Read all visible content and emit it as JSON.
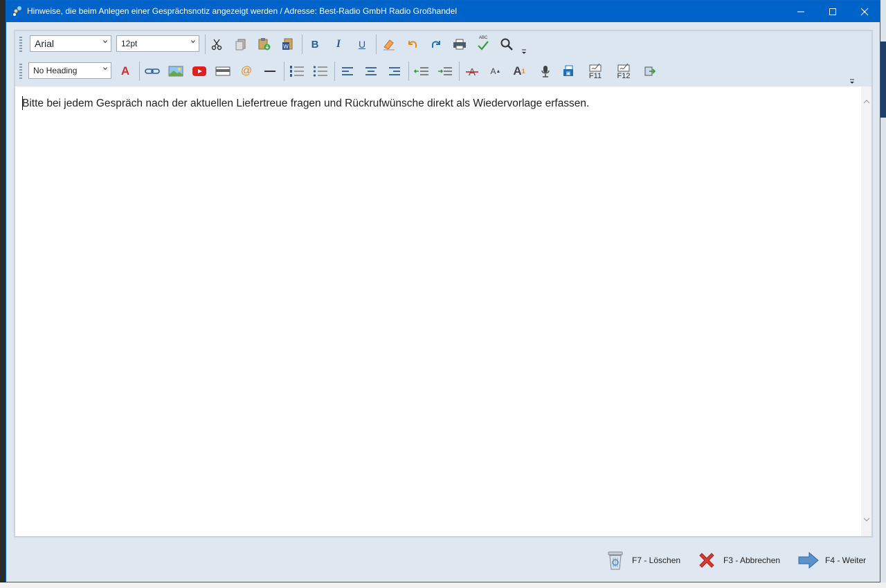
{
  "window": {
    "title": "Hinweise, die beim Anlegen einer Gesprächsnotiz angezeigt werden / Adresse: Best-Radio GmbH Radio Großhandel",
    "minimize_icon": "minimize-icon",
    "maximize_icon": "maximize-icon",
    "close_icon": "close-icon"
  },
  "toolbar1": {
    "font_family": "Arial",
    "font_size": "12pt",
    "buttons": [
      "cut-icon",
      "copy-icon",
      "paste-icon",
      "paste-word-icon",
      "bold-icon",
      "italic-icon",
      "underline-icon",
      "eraser-icon",
      "undo-icon",
      "redo-icon",
      "print-icon",
      "spellcheck-icon",
      "search-icon"
    ],
    "bold_label": "B",
    "italic_label": "I",
    "underline_label": "U",
    "spell_label": "ABC"
  },
  "toolbar2": {
    "heading": "No Heading",
    "font_color_label": "A",
    "email_label": "@",
    "f11_label": "F11",
    "f12_label": "F12",
    "superscript_label": "A",
    "subscript_label": "A",
    "subscript_digit": "1"
  },
  "editor": {
    "text": "Bitte bei jedem Gespräch nach der aktuellen Liefertreue fragen und Rückrufwünsche direkt als Wiedervorlage erfassen."
  },
  "footer": {
    "delete_label": "F7 - Löschen",
    "cancel_label": "F3 - Abbrechen",
    "next_label": "F4 - Weiter"
  },
  "colors": {
    "titlebar": "#0063c9",
    "accent_blue": "#1f6fb5",
    "red": "#d32f2f"
  }
}
